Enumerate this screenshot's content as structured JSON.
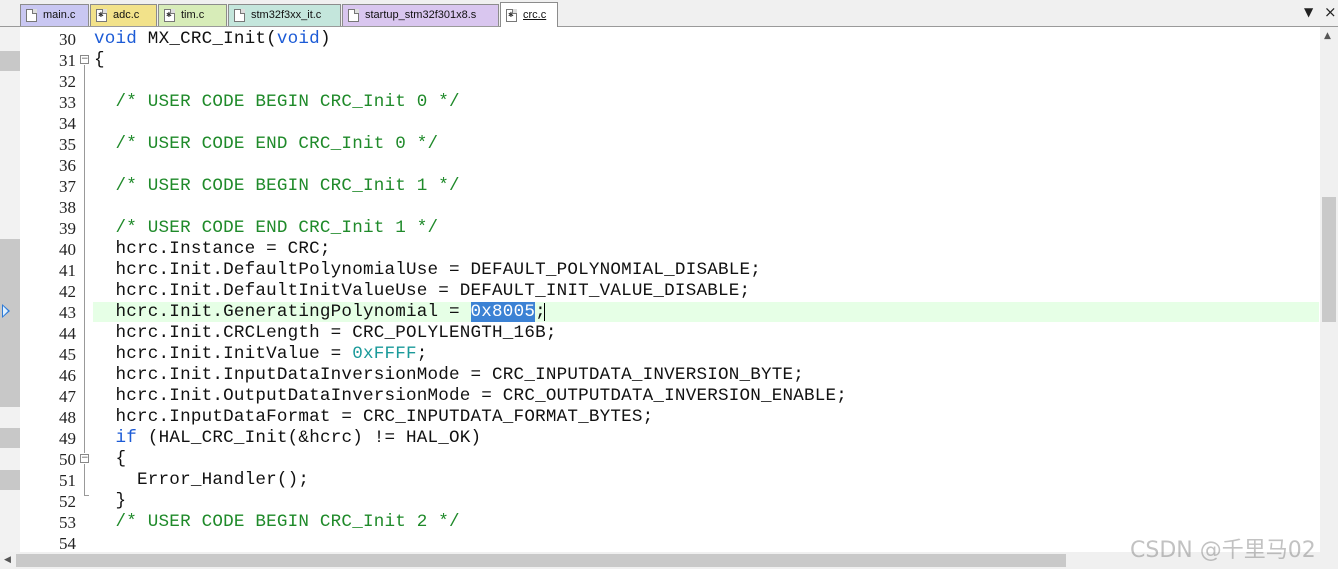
{
  "tabs": [
    {
      "label": "main.c",
      "color": "#c9c7f2",
      "icon": "c-file-icon",
      "active": false
    },
    {
      "label": "adc.c",
      "color": "#f2e28a",
      "icon": "c-file-icon",
      "active": false
    },
    {
      "label": "tim.c",
      "color": "#d7ecb8",
      "icon": "c-file-icon",
      "active": false
    },
    {
      "label": "stm32f3xx_it.c",
      "color": "#c4e6dc",
      "icon": "c-file-icon",
      "active": false
    },
    {
      "label": "startup_stm32f301x8.s",
      "color": "#d9c6ef",
      "icon": "asm-file-icon",
      "active": false
    },
    {
      "label": "crc.c",
      "color": "#ffffff",
      "icon": "c-file-icon",
      "active": true
    }
  ],
  "tab_controls": {
    "dropdown": "▼",
    "close": "×"
  },
  "editor": {
    "current_line": 43,
    "selected_text": "0x8005",
    "lines": [
      {
        "n": "30",
        "text": "void MX_CRC_Init(void)"
      },
      {
        "n": "31",
        "text": "{"
      },
      {
        "n": "32",
        "text": ""
      },
      {
        "n": "33",
        "text": "  /* USER CODE BEGIN CRC_Init 0 */"
      },
      {
        "n": "34",
        "text": ""
      },
      {
        "n": "35",
        "text": "  /* USER CODE END CRC_Init 0 */"
      },
      {
        "n": "36",
        "text": ""
      },
      {
        "n": "37",
        "text": "  /* USER CODE BEGIN CRC_Init 1 */"
      },
      {
        "n": "38",
        "text": ""
      },
      {
        "n": "39",
        "text": "  /* USER CODE END CRC_Init 1 */"
      },
      {
        "n": "40",
        "text": "  hcrc.Instance = CRC;"
      },
      {
        "n": "41",
        "text": "  hcrc.Init.DefaultPolynomialUse = DEFAULT_POLYNOMIAL_DISABLE;"
      },
      {
        "n": "42",
        "text": "  hcrc.Init.DefaultInitValueUse = DEFAULT_INIT_VALUE_DISABLE;"
      },
      {
        "n": "43",
        "text": "  hcrc.Init.GeneratingPolynomial = 0x8005;"
      },
      {
        "n": "44",
        "text": "  hcrc.Init.CRCLength = CRC_POLYLENGTH_16B;"
      },
      {
        "n": "45",
        "text": "  hcrc.Init.InitValue = 0xFFFF;"
      },
      {
        "n": "46",
        "text": "  hcrc.Init.InputDataInversionMode = CRC_INPUTDATA_INVERSION_BYTE;"
      },
      {
        "n": "47",
        "text": "  hcrc.Init.OutputDataInversionMode = CRC_OUTPUTDATA_INVERSION_ENABLE;"
      },
      {
        "n": "48",
        "text": "  hcrc.InputDataFormat = CRC_INPUTDATA_FORMAT_BYTES;"
      },
      {
        "n": "49",
        "text": "  if (HAL_CRC_Init(&hcrc) != HAL_OK)"
      },
      {
        "n": "50",
        "text": "  {"
      },
      {
        "n": "51",
        "text": "    Error_Handler();"
      },
      {
        "n": "52",
        "text": "  }"
      },
      {
        "n": "53",
        "text": "  /* USER CODE BEGIN CRC_Init 2 */"
      },
      {
        "n": "54",
        "text": ""
      }
    ]
  },
  "watermark": "CSDN @千里马02",
  "colors": {
    "keyword": "#1c5bd6",
    "comment": "#1f8a2a",
    "number": "#1a9a9a",
    "current_line_bg": "#e6ffe6",
    "selection": "#3c82d4"
  }
}
